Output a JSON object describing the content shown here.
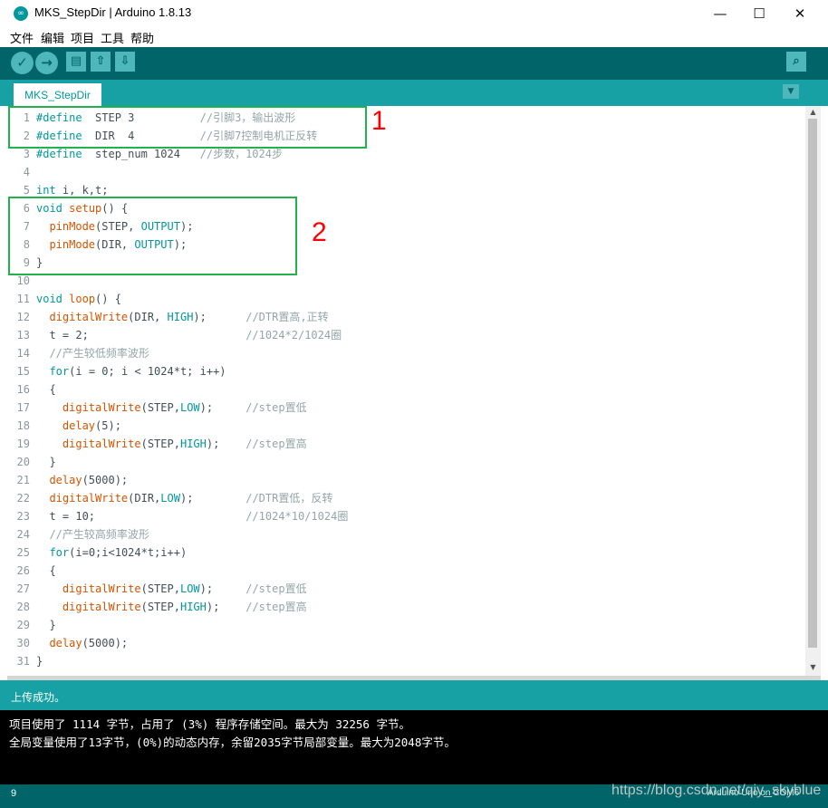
{
  "window": {
    "title": "MKS_StepDir | Arduino 1.8.13",
    "minimize": "—",
    "maximize": "☐",
    "close": "✕"
  },
  "menu": [
    "文件",
    "编辑",
    "项目",
    "工具",
    "帮助"
  ],
  "toolbar": {
    "verify": "✓",
    "upload": "→",
    "new": "▤",
    "open": "⇧",
    "save": "⇩",
    "serial_monitor": "⌕"
  },
  "tab": {
    "name": "MKS_StepDir",
    "menu": "▼"
  },
  "code": [
    {
      "n": "1",
      "parts": [
        [
          "kw",
          "#define"
        ],
        [
          "",
          "  STEP 3          "
        ],
        [
          "cm",
          "//引脚3，输出波形"
        ]
      ]
    },
    {
      "n": "2",
      "parts": [
        [
          "kw",
          "#define"
        ],
        [
          "",
          "  DIR  4          "
        ],
        [
          "cm",
          "//引脚7控制电机正反转"
        ]
      ]
    },
    {
      "n": "3",
      "parts": [
        [
          "kw",
          "#define"
        ],
        [
          "",
          "  step_num 1024   "
        ],
        [
          "cm",
          "//步数，1024步"
        ]
      ]
    },
    {
      "n": "4",
      "parts": []
    },
    {
      "n": "5",
      "parts": [
        [
          "kw",
          "int"
        ],
        [
          "",
          " i, k,t;"
        ]
      ]
    },
    {
      "n": "6",
      "parts": [
        [
          "kw",
          "void"
        ],
        [
          "",
          " "
        ],
        [
          "fn",
          "setup"
        ],
        [
          "",
          "() {"
        ]
      ]
    },
    {
      "n": "7",
      "parts": [
        [
          "",
          "  "
        ],
        [
          "fn",
          "pinMode"
        ],
        [
          "",
          "(STEP, "
        ],
        [
          "kw",
          "OUTPUT"
        ],
        [
          "",
          ");"
        ]
      ]
    },
    {
      "n": "8",
      "parts": [
        [
          "",
          "  "
        ],
        [
          "fn",
          "pinMode"
        ],
        [
          "",
          "(DIR, "
        ],
        [
          "kw",
          "OUTPUT"
        ],
        [
          "",
          ");"
        ]
      ]
    },
    {
      "n": "9",
      "parts": [
        [
          "",
          "}"
        ]
      ]
    },
    {
      "n": "10",
      "parts": []
    },
    {
      "n": "11",
      "parts": [
        [
          "kw",
          "void"
        ],
        [
          "",
          " "
        ],
        [
          "fn",
          "loop"
        ],
        [
          "",
          "() {"
        ]
      ]
    },
    {
      "n": "12",
      "parts": [
        [
          "",
          "  "
        ],
        [
          "fn",
          "digitalWrite"
        ],
        [
          "",
          "(DIR, "
        ],
        [
          "kw",
          "HIGH"
        ],
        [
          "",
          ");      "
        ],
        [
          "cm",
          "//DTR置高,正转"
        ]
      ]
    },
    {
      "n": "13",
      "parts": [
        [
          "",
          "  t = 2;                        "
        ],
        [
          "cm",
          "//1024*2/1024圈"
        ]
      ]
    },
    {
      "n": "14",
      "parts": [
        [
          "",
          "  "
        ],
        [
          "cm",
          "//产生较低频率波形"
        ]
      ]
    },
    {
      "n": "15",
      "parts": [
        [
          "",
          "  "
        ],
        [
          "kw",
          "for"
        ],
        [
          "",
          "(i = 0; i < 1024*t; i++)"
        ]
      ]
    },
    {
      "n": "16",
      "parts": [
        [
          "",
          "  {"
        ]
      ]
    },
    {
      "n": "17",
      "parts": [
        [
          "",
          "    "
        ],
        [
          "fn",
          "digitalWrite"
        ],
        [
          "",
          "(STEP,"
        ],
        [
          "kw",
          "LOW"
        ],
        [
          "",
          ");     "
        ],
        [
          "cm",
          "//step置低"
        ]
      ]
    },
    {
      "n": "18",
      "parts": [
        [
          "",
          "    "
        ],
        [
          "fn",
          "delay"
        ],
        [
          "",
          "(5);"
        ]
      ]
    },
    {
      "n": "19",
      "parts": [
        [
          "",
          "    "
        ],
        [
          "fn",
          "digitalWrite"
        ],
        [
          "",
          "(STEP,"
        ],
        [
          "kw",
          "HIGH"
        ],
        [
          "",
          ");    "
        ],
        [
          "cm",
          "//step置高"
        ]
      ]
    },
    {
      "n": "20",
      "parts": [
        [
          "",
          "  }"
        ]
      ]
    },
    {
      "n": "21",
      "parts": [
        [
          "",
          "  "
        ],
        [
          "fn",
          "delay"
        ],
        [
          "",
          "(5000);"
        ]
      ]
    },
    {
      "n": "22",
      "parts": [
        [
          "",
          "  "
        ],
        [
          "fn",
          "digitalWrite"
        ],
        [
          "",
          "(DIR,"
        ],
        [
          "kw",
          "LOW"
        ],
        [
          "",
          ");        "
        ],
        [
          "cm",
          "//DTR置低，反转"
        ]
      ]
    },
    {
      "n": "23",
      "parts": [
        [
          "",
          "  t = 10;                       "
        ],
        [
          "cm",
          "//1024*10/1024圈"
        ]
      ]
    },
    {
      "n": "24",
      "parts": [
        [
          "",
          "  "
        ],
        [
          "cm",
          "//产生较高频率波形"
        ]
      ]
    },
    {
      "n": "25",
      "parts": [
        [
          "",
          "  "
        ],
        [
          "kw",
          "for"
        ],
        [
          "",
          "(i=0;i<1024*t;i++)"
        ]
      ]
    },
    {
      "n": "26",
      "parts": [
        [
          "",
          "  {"
        ]
      ]
    },
    {
      "n": "27",
      "parts": [
        [
          "",
          "    "
        ],
        [
          "fn",
          "digitalWrite"
        ],
        [
          "",
          "(STEP,"
        ],
        [
          "kw",
          "LOW"
        ],
        [
          "",
          ");     "
        ],
        [
          "cm",
          "//step置低"
        ]
      ]
    },
    {
      "n": "28",
      "parts": [
        [
          "",
          "    "
        ],
        [
          "fn",
          "digitalWrite"
        ],
        [
          "",
          "(STEP,"
        ],
        [
          "kw",
          "HIGH"
        ],
        [
          "",
          ");    "
        ],
        [
          "cm",
          "//step置高"
        ]
      ]
    },
    {
      "n": "29",
      "parts": [
        [
          "",
          "  }"
        ]
      ]
    },
    {
      "n": "30",
      "parts": [
        [
          "",
          "  "
        ],
        [
          "fn",
          "delay"
        ],
        [
          "",
          "(5000);"
        ]
      ]
    },
    {
      "n": "31",
      "parts": [
        [
          "",
          "}"
        ]
      ]
    }
  ],
  "annotations": {
    "box1": "1",
    "box2": "2"
  },
  "status": {
    "message": "上传成功。"
  },
  "console": {
    "line1": "项目使用了 1114 字节，占用了 (3%) 程序存储空间。最大为 32256 字节。",
    "line2": "全局变量使用了13字节，(0%)的动态内存，余留2035字节局部变量。最大为2048字节。"
  },
  "footer": {
    "line_number": "9",
    "board": "Arduino Uno on COM6"
  },
  "watermark": "https://blog.csdn.net/qiy_skyblue",
  "colors": {
    "teal_dark": "#006468",
    "teal": "#17a1a5",
    "keyword": "#00979d",
    "function": "#d35400",
    "comment": "#95a5a6",
    "highlight_box": "#22b14c",
    "annotation": "#ff0000"
  }
}
